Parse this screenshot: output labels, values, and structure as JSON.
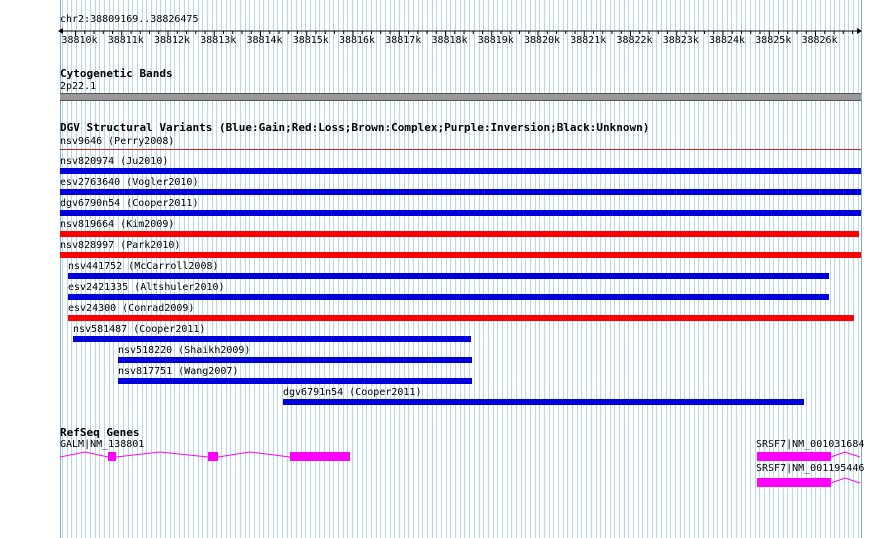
{
  "ruler": {
    "coords": "chr2:38809169..38826475",
    "ticks": [
      "38810k",
      "38811k",
      "38812k",
      "38813k",
      "38814k",
      "38815k",
      "38816k",
      "38817k",
      "38818k",
      "38819k",
      "38820k",
      "38821k",
      "38822k",
      "38823k",
      "38824k",
      "38825k",
      "38826k"
    ]
  },
  "cytobands": {
    "title": "Cytogenetic Bands",
    "band": "2p22.1"
  },
  "dgv": {
    "title": "DGV Structural Variants (Blue:Gain;Red:Loss;Brown:Complex;Purple:Inversion;Black:Unknown)",
    "variants": [
      {
        "label": "nsv9646 (Perry2008)",
        "type": "Loss",
        "color": "#cc2222",
        "thin": true
      },
      {
        "label": "nsv820974 (Ju2010)",
        "type": "Gain",
        "color": "#0000dd"
      },
      {
        "label": "esv2763640 (Vogler2010)",
        "type": "Gain",
        "color": "#0000dd"
      },
      {
        "label": "dgv6790n54 (Cooper2011)",
        "type": "Gain",
        "color": "#0000dd"
      },
      {
        "label": "nsv819664 (Kim2009)",
        "type": "Loss",
        "color": "#ff0000"
      },
      {
        "label": "nsv828997 (Park2010)",
        "type": "Loss",
        "color": "#ff0000"
      },
      {
        "label": "nsv441752 (McCarroll2008)",
        "type": "Gain",
        "color": "#0000dd"
      },
      {
        "label": "esv2421335 (Altshuler2010)",
        "type": "Gain",
        "color": "#0000dd"
      },
      {
        "label": "esv24300 (Conrad2009)",
        "type": "Loss",
        "color": "#ff0000"
      },
      {
        "label": "nsv581487 (Cooper2011)",
        "type": "Gain",
        "color": "#0000dd"
      },
      {
        "label": "nsv518220 (Shaikh2009)",
        "type": "Gain",
        "color": "#0000dd"
      },
      {
        "label": "nsv817751 (Wang2007)",
        "type": "Gain",
        "color": "#0000dd"
      },
      {
        "label": "dgv6791n54 (Cooper2011)",
        "type": "Gain",
        "color": "#0000dd"
      }
    ]
  },
  "refseq": {
    "title": "RefSeq Genes",
    "genes": [
      {
        "label": "GALM|NM_138801"
      },
      {
        "label": "SRSF7|NM_001031684"
      },
      {
        "label": "SRSF7|NM_001195446"
      }
    ]
  },
  "colors": {
    "gain": "#0000dd",
    "loss": "#ff0000",
    "gene": "#ff00ff",
    "grid": "#b8d8e8",
    "band": "#999999"
  }
}
